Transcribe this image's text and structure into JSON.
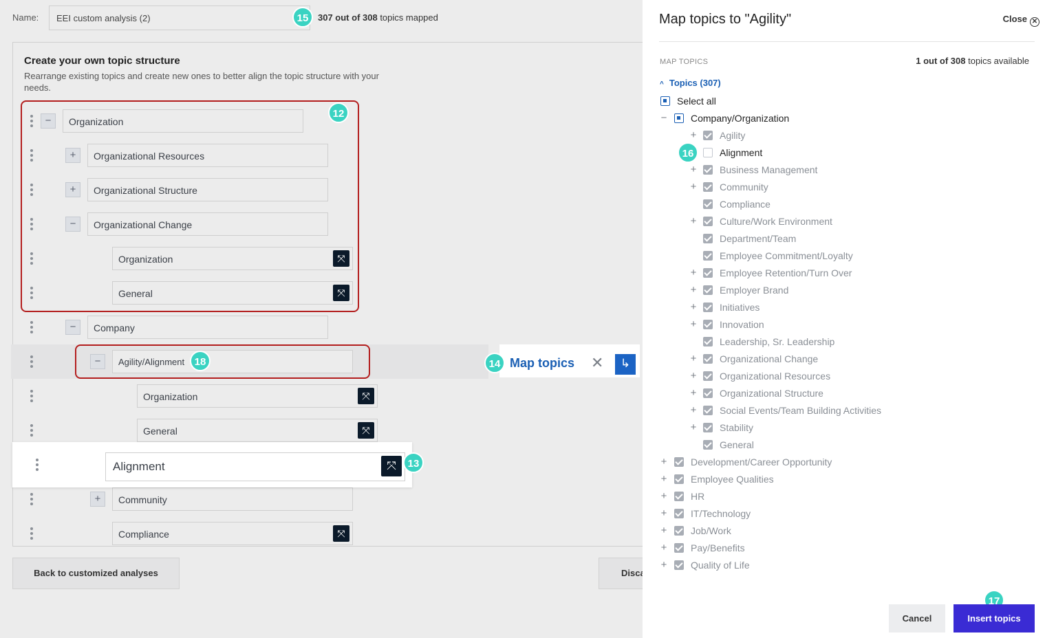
{
  "header": {
    "name_label": "Name:",
    "name_value": "EEI custom analysis (2)",
    "mapped_count": "307 out of 308",
    "mapped_suffix": " topics mapped"
  },
  "structure": {
    "title": "Create your own topic structure",
    "description": "Rearrange existing topics and create new ones to better align the topic structure with your needs.",
    "topics": {
      "organization": "Organization",
      "org_resources": "Organizational Resources",
      "org_structure": "Organizational Structure",
      "org_change": "Organizational Change",
      "org_change_organization": "Organization",
      "org_change_general": "General",
      "company": "Company",
      "agility_alignment": "Agility/Alignment",
      "aa_organization": "Organization",
      "aa_general": "General",
      "alignment_dragged": "Alignment",
      "community": "Community",
      "compliance": "Compliance"
    },
    "map_topics_label": "Map topics"
  },
  "annotations": {
    "b12": "12",
    "b13": "13",
    "b14": "14",
    "b15": "15",
    "b16": "16",
    "b17": "17",
    "b18": "18"
  },
  "footer": {
    "back_label": "Back to customized analyses",
    "discard_label": "Disca"
  },
  "drawer": {
    "title": "Map topics to \"Agility\"",
    "close_label": "Close",
    "section_label": "MAP TOPICS",
    "available_count": "1 out of 308",
    "available_suffix": " topics available",
    "topics_toggle": "Topics (307)",
    "select_all": "Select all",
    "parent": "Company/Organization",
    "children": [
      "Agility",
      "Alignment",
      "Business Management",
      "Community",
      "Compliance",
      "Culture/Work Environment",
      "Department/Team",
      "Employee Commitment/Loyalty",
      "Employee Retention/Turn Over",
      "Employer Brand",
      "Initiatives",
      "Innovation",
      "Leadership, Sr. Leadership",
      "Organizational Change",
      "Organizational Resources",
      "Organizational Structure",
      "Social Events/Team Building Activities",
      "Stability",
      "General"
    ],
    "top_level": [
      "Development/Career Opportunity",
      "Employee Qualities",
      "HR",
      "IT/Technology",
      "Job/Work",
      "Pay/Benefits",
      "Quality of Life"
    ],
    "cancel_label": "Cancel",
    "insert_label": "Insert topics"
  },
  "colors": {
    "accent_blue": "#1a5fb4",
    "insert_purple": "#3a2bd4",
    "badge_teal": "#3ad3c2",
    "frame_red": "#b31d1d"
  }
}
